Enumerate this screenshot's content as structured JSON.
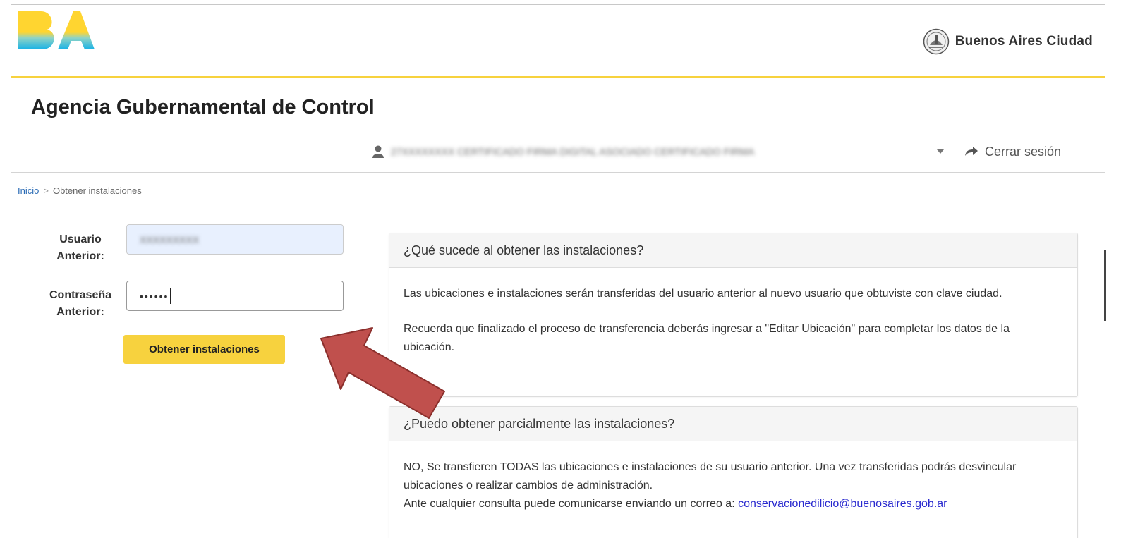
{
  "header": {
    "logo_text": "BA",
    "city_name": "Buenos Aires Ciudad",
    "agency_title": "Agencia Gubernamental de Control"
  },
  "user_bar": {
    "user_name": "27XXXXXXXX CERTIFICADO FIRMA DIGITAL ASOCIADO CERTIFICADO FIRMA",
    "logout_label": "Cerrar sesión"
  },
  "breadcrumb": {
    "home": "Inicio",
    "separator": ">",
    "current": "Obtener instalaciones"
  },
  "form": {
    "user_label_line1": "Usuario",
    "user_label_line2": "Anterior:",
    "user_value": "XXXXXXXXX",
    "password_label_line1": "Contraseña",
    "password_label_line2": "Anterior:",
    "password_value": "••••••",
    "submit_label": "Obtener instalaciones"
  },
  "panels": [
    {
      "title": "¿Qué sucede al obtener las instalaciones?",
      "paragraph1": "Las ubicaciones e instalaciones serán transferidas del usuario anterior al nuevo usuario que obtuviste con clave ciudad.",
      "paragraph2": "Recuerda que finalizado el proceso de transferencia deberás ingresar a \"Editar Ubicación\" para completar los datos de la ubicación."
    },
    {
      "title": "¿Puedo obtener parcialmente las instalaciones?",
      "paragraph1": "NO, Se transfieren TODAS las ubicaciones e instalaciones de su usuario anterior. Una vez transferidas podrás desvincular ubicaciones o realizar cambios de administración.",
      "paragraph2": "Ante cualquier consulta puede comunicarse enviando un correo a: ",
      "email": "conservacionedilicio@buenosaires.gob.ar"
    }
  ],
  "colors": {
    "accent_yellow": "#f7d23e",
    "link_blue": "#2a6bb5",
    "annotation_arrow": "#c0504d"
  }
}
